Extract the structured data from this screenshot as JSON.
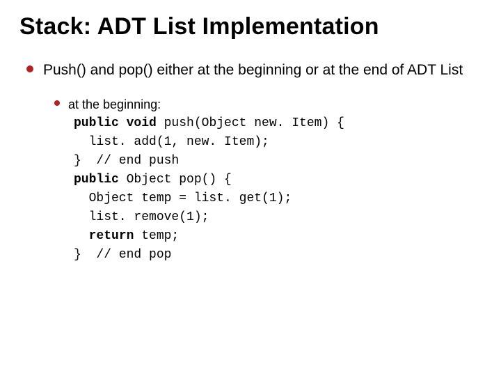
{
  "title": "Stack: ADT List Implementation",
  "bullet1": "Push() and pop() either at the beginning or at the end of ADT List",
  "sub_intro": "at the beginning:",
  "code": {
    "l1a": "public void",
    "l1b": " push(Object new. Item) {",
    "l2": "  list. add(1, new. Item);",
    "l3": "}  // end push",
    "l4a": "public",
    "l4b": " Object pop() {",
    "l5": "  Object temp = list. get(1);",
    "l6": "  list. remove(1);",
    "l7a": "  ",
    "l7b": "return",
    "l7c": " temp;",
    "l8": "}  // end pop"
  }
}
